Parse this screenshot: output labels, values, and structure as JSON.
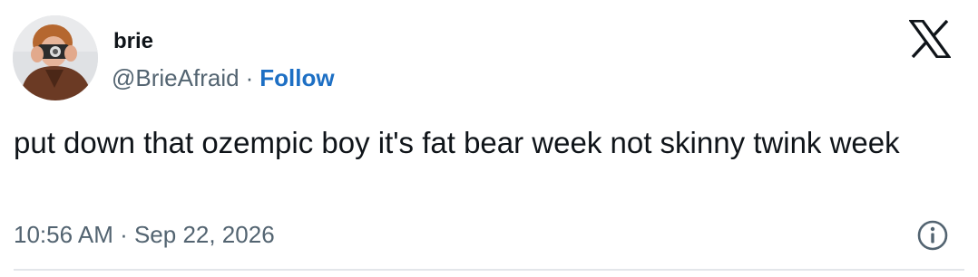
{
  "author": {
    "display_name": "brie",
    "handle": "@BrieAfraid",
    "separator": "·",
    "follow_label": "Follow",
    "avatar_icon": "avatar-photo"
  },
  "tweet": {
    "text": "put down that ozempic boy it's fat bear week not skinny twink week",
    "timestamp": "10:56 AM · Sep 22, 2026"
  },
  "icons": {
    "brand": "x-logo-icon",
    "info": "info-icon"
  },
  "colors": {
    "text": "#0f1419",
    "secondary": "#536471",
    "link": "#1d6fc4",
    "divider": "#e3e6ea"
  }
}
